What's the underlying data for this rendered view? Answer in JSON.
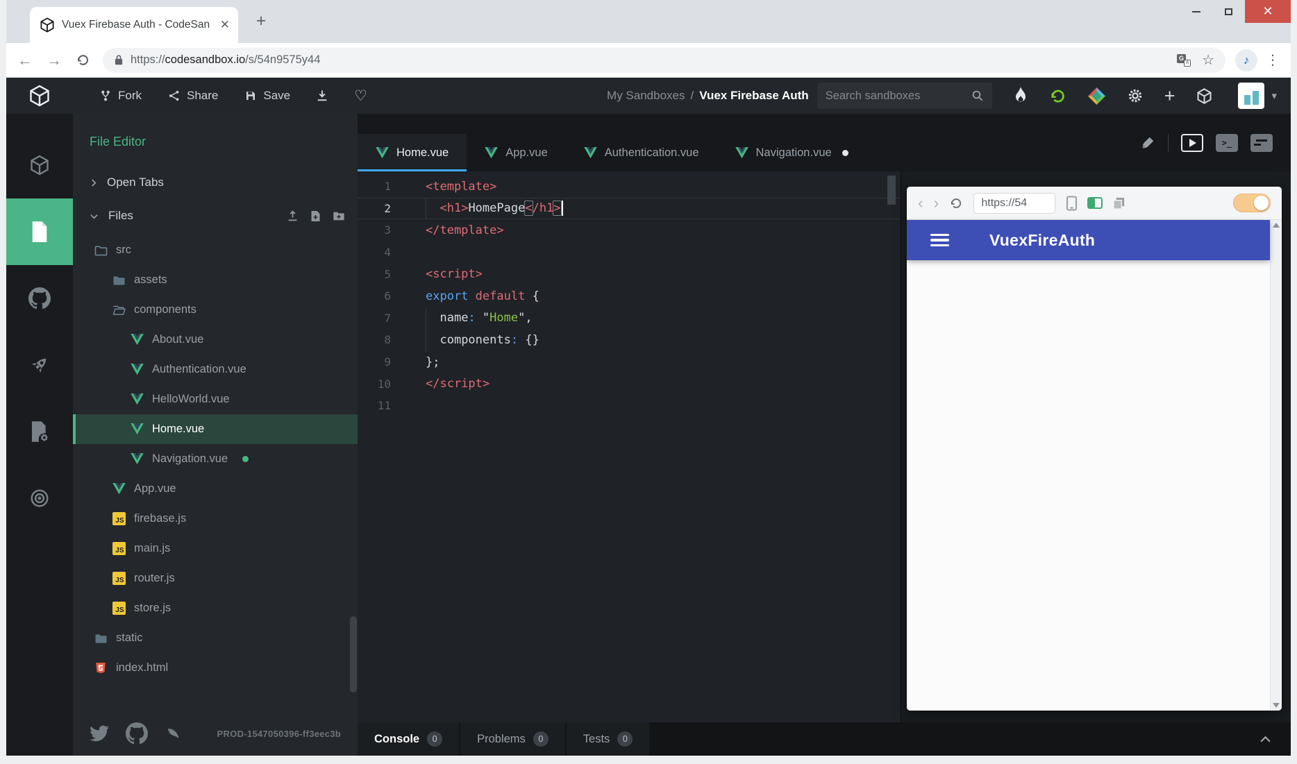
{
  "browser": {
    "tab_title": "Vuex Firebase Auth - CodeSan",
    "url": {
      "scheme": "https://",
      "domain": "codesandbox.io",
      "path": "/s/54n9575y44"
    }
  },
  "header": {
    "fork_label": "Fork",
    "share_label": "Share",
    "save_label": "Save",
    "breadcrumb": {
      "group": "My Sandboxes",
      "separator": "/",
      "title": "Vuex Firebase Auth"
    },
    "search_placeholder": "Search sandboxes",
    "icon_buttons": [
      "flame",
      "refresh",
      "gem",
      "settings",
      "plus",
      "sandbox"
    ]
  },
  "activity_bar": {
    "items": [
      {
        "icon": "sandbox-cube",
        "active": false
      },
      {
        "icon": "file-editor",
        "active": true
      },
      {
        "icon": "github",
        "active": false
      },
      {
        "icon": "rocket",
        "active": false
      },
      {
        "icon": "file-settings",
        "active": false
      },
      {
        "icon": "live",
        "active": false
      }
    ]
  },
  "sidebar": {
    "title": "File Editor",
    "sections": {
      "open_tabs": "Open Tabs",
      "files": "Files"
    },
    "files_actions": [
      "upload",
      "new-file",
      "new-folder"
    ],
    "files": [
      {
        "name": "src",
        "icon": "folder",
        "depth": 0
      },
      {
        "name": "assets",
        "icon": "folder-filled",
        "depth": 1
      },
      {
        "name": "components",
        "icon": "folder-open",
        "depth": 1
      },
      {
        "name": "About.vue",
        "icon": "vue",
        "depth": 2
      },
      {
        "name": "Authentication.vue",
        "icon": "vue",
        "depth": 2
      },
      {
        "name": "HelloWorld.vue",
        "icon": "vue",
        "depth": 2
      },
      {
        "name": "Home.vue",
        "icon": "vue",
        "depth": 2,
        "selected": true
      },
      {
        "name": "Navigation.vue",
        "icon": "vue",
        "depth": 2,
        "modified": true
      },
      {
        "name": "App.vue",
        "icon": "vue",
        "depth": 1
      },
      {
        "name": "firebase.js",
        "icon": "js",
        "depth": 1
      },
      {
        "name": "main.js",
        "icon": "js",
        "depth": 1
      },
      {
        "name": "router.js",
        "icon": "js",
        "depth": 1
      },
      {
        "name": "store.js",
        "icon": "js",
        "depth": 1
      },
      {
        "name": "static",
        "icon": "folder-filled",
        "depth": 0
      },
      {
        "name": "index.html",
        "icon": "html",
        "depth": 0
      }
    ],
    "build_label": "PROD-1547050396-ff3eec3b"
  },
  "editor": {
    "tabs": [
      {
        "label": "Home.vue",
        "active": true
      },
      {
        "label": "App.vue"
      },
      {
        "label": "Authentication.vue"
      },
      {
        "label": "Navigation.vue",
        "modified": true
      }
    ],
    "action_icons": [
      "prettier-brush",
      "browser-preview",
      "terminal",
      "layout"
    ],
    "code": [
      {
        "n": 1,
        "tokens": [
          {
            "t": "<template>",
            "c": "tag"
          }
        ]
      },
      {
        "n": 2,
        "active": true,
        "guide": true,
        "tokens": [
          {
            "t": "  "
          },
          {
            "t": "<h1>",
            "c": "tag"
          },
          {
            "t": "HomePage"
          },
          {
            "t": "<",
            "c": "tag",
            "box": true
          },
          {
            "t": "/h1",
            "c": "tag"
          },
          {
            "t": ">",
            "c": "tag",
            "box": true,
            "cursor": true
          }
        ]
      },
      {
        "n": 3,
        "tokens": [
          {
            "t": "</template>",
            "c": "tag"
          }
        ]
      },
      {
        "n": 4,
        "tokens": []
      },
      {
        "n": 5,
        "tokens": [
          {
            "t": "<script>",
            "c": "tag"
          }
        ]
      },
      {
        "n": 6,
        "tokens": [
          {
            "t": "export",
            "c": "kw"
          },
          {
            "t": " "
          },
          {
            "t": "default",
            "c": "kw2"
          },
          {
            "t": " {"
          }
        ]
      },
      {
        "n": 7,
        "guide": true,
        "tokens": [
          {
            "t": "  "
          },
          {
            "t": "name"
          },
          {
            "t": ":",
            "c": "op"
          },
          {
            "t": " \""
          },
          {
            "t": "Home",
            "c": "str"
          },
          {
            "t": "\","
          }
        ]
      },
      {
        "n": 8,
        "guide": true,
        "tokens": [
          {
            "t": "  "
          },
          {
            "t": "components"
          },
          {
            "t": ":",
            "c": "op"
          },
          {
            "t": " {}"
          }
        ]
      },
      {
        "n": 9,
        "tokens": [
          {
            "t": "};"
          }
        ]
      },
      {
        "n": 10,
        "tokens": [
          {
            "t": "</script>",
            "c": "tag"
          }
        ]
      },
      {
        "n": 11,
        "tokens": []
      }
    ]
  },
  "console": {
    "tabs": [
      {
        "label": "Console",
        "count": "0",
        "active": true
      },
      {
        "label": "Problems",
        "count": "0"
      },
      {
        "label": "Tests",
        "count": "0"
      }
    ]
  },
  "preview": {
    "url_value": "https://54",
    "nav_icons": [
      "device",
      "responsive-green",
      "copy"
    ],
    "toggle_on": true,
    "app_title": "VuexFireAuth"
  },
  "footer_icons": [
    "twitter",
    "github",
    "swoosh"
  ],
  "colors": {
    "accent_green": "#4ab586",
    "tab_underline_blue": "#40a8f2",
    "vue_green": "#41b883",
    "vue_dark": "#35495e",
    "js_yellow": "#efc836",
    "html_orange": "#e5593f",
    "preview_navbar_indigo": "#3d4eb5",
    "toggle_orange": "#f7cb90",
    "close_button_red": "#cb5149",
    "code_tag": "#e06c75",
    "code_keyword": "#57a5f4",
    "code_string": "#8dc149"
  }
}
